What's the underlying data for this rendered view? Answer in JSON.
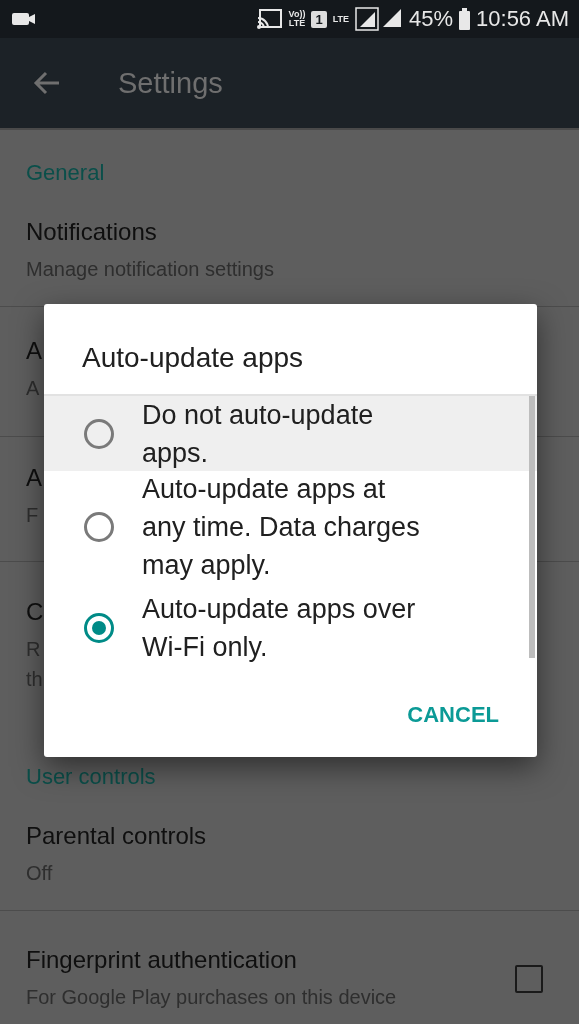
{
  "status_bar": {
    "network_labels": [
      "Vo))",
      "LTE"
    ],
    "sim_slot": "1",
    "data_label": "LTE",
    "battery": "45%",
    "time": "10:56 AM"
  },
  "app_bar": {
    "title": "Settings"
  },
  "settings": [
    {
      "kind": "header",
      "title": "General"
    },
    {
      "kind": "item",
      "title": "Notifications",
      "subtitle": "Manage notification settings"
    },
    {
      "kind": "item",
      "title": "A",
      "subtitle": "A"
    },
    {
      "kind": "item",
      "title": "A",
      "subtitle": "F"
    },
    {
      "kind": "item",
      "title": "C",
      "subtitle": "R\nth"
    },
    {
      "kind": "header",
      "title": "User controls"
    },
    {
      "kind": "item",
      "title": "Parental controls",
      "subtitle": "Off"
    },
    {
      "kind": "check",
      "title": "Fingerprint authentication",
      "subtitle": "For Google Play purchases on this device",
      "checked": false
    }
  ],
  "dialog": {
    "title": "Auto-update apps",
    "options": [
      {
        "label": "Do not auto-update apps.",
        "selected": false,
        "highlighted": true
      },
      {
        "label": "Auto-update apps at any time. Data charges may apply.",
        "selected": false,
        "highlighted": false
      },
      {
        "label": "Auto-update apps over Wi-Fi only.",
        "selected": true,
        "highlighted": false
      }
    ],
    "button": "CANCEL"
  }
}
